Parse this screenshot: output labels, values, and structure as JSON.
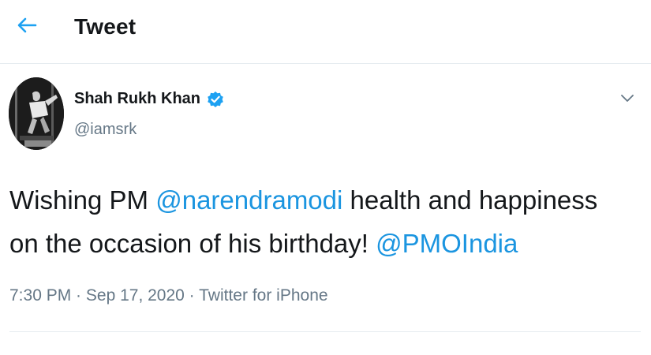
{
  "header": {
    "title": "Tweet",
    "back_icon": "arrow-left-icon"
  },
  "tweet": {
    "author": {
      "name": "Shah Rukh Khan",
      "handle": "@iamsrk",
      "verified": true,
      "verified_icon": "verified-badge-icon"
    },
    "menu_icon": "chevron-down-icon",
    "text": {
      "part1": "Wishing PM ",
      "mention1": "@narendramodi",
      "part2": " health and happiness on the occasion of his birthday! ",
      "mention2": "@PMOIndia"
    },
    "meta": {
      "time": "7:30 PM",
      "separator1": " · ",
      "date": "Sep 17, 2020",
      "separator2": " · ",
      "source": "Twitter for iPhone"
    }
  },
  "colors": {
    "accent": "#1b95e0",
    "text": "#14171a",
    "secondary": "#657786",
    "border": "#e6ecf0"
  }
}
